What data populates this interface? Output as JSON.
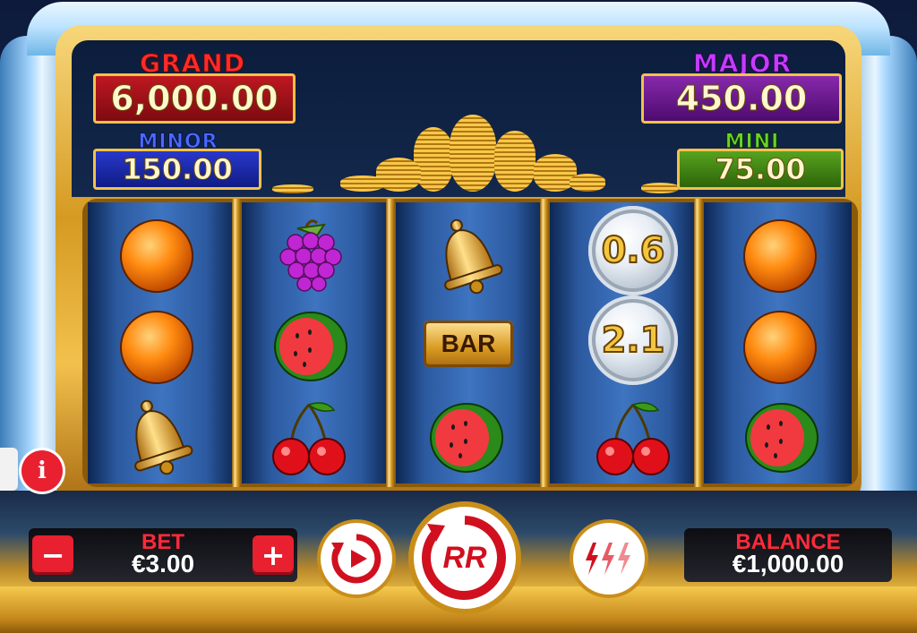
{
  "jackpots": {
    "grand": {
      "title": "GRAND",
      "value": "6,000.00"
    },
    "minor": {
      "title": "MINOR",
      "value": "150.00"
    },
    "major": {
      "title": "MAJOR",
      "value": "450.00"
    },
    "mini": {
      "title": "MINI",
      "value": "75.00"
    }
  },
  "reels": [
    [
      "orange",
      "orange",
      "bell"
    ],
    [
      "grapes",
      "watermelon",
      "cherries"
    ],
    [
      "bell",
      "bar",
      "watermelon"
    ],
    [
      "coin",
      "coin",
      "cherries"
    ],
    [
      "orange",
      "orange",
      "watermelon"
    ]
  ],
  "symbol_text": {
    "bar": "BAR",
    "coin_values": {
      "reel4_row1": "0.6",
      "reel4_row2": "2.1"
    }
  },
  "controls": {
    "info_label": "i",
    "bet_label": "BET",
    "bet_value": "€3.00",
    "minus_label": "−",
    "plus_label": "+",
    "spin_logo": "RR",
    "balance_label": "BALANCE",
    "balance_value": "€1,000.00"
  },
  "colors": {
    "accent_red": "#e8202f",
    "grand_red": "#a8101a",
    "major_purple": "#6a1a8a",
    "minor_blue": "#1a2aa0",
    "mini_green": "#3a7a10"
  },
  "icons": [
    "info-icon",
    "autoplay-icon",
    "spin-icon",
    "turbo-icon"
  ]
}
